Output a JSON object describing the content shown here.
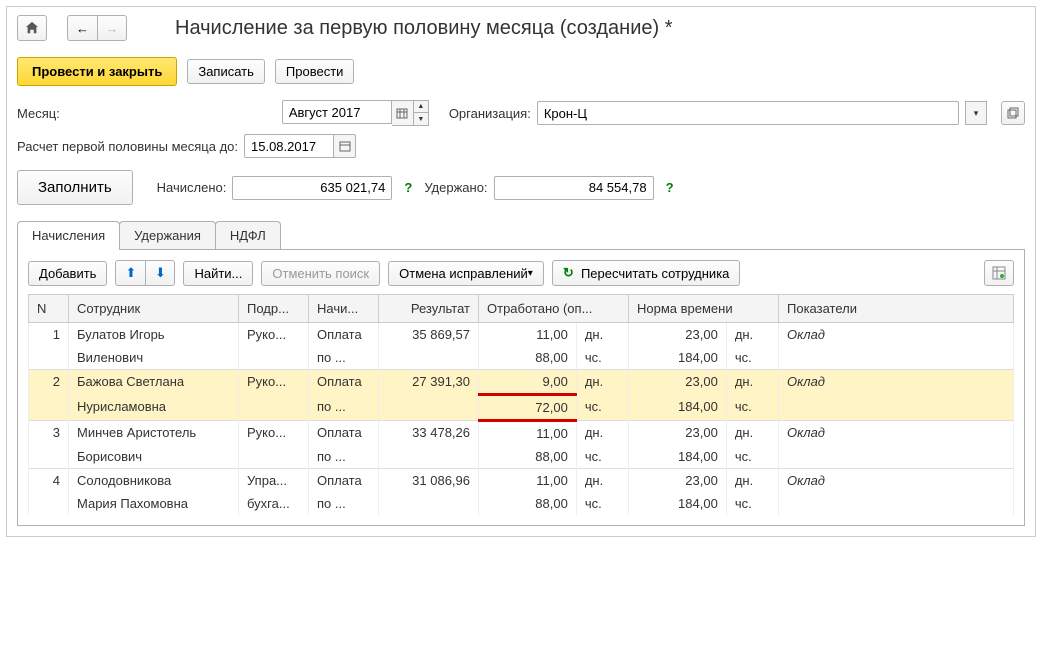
{
  "title": "Начисление за первую половину месяца (создание) *",
  "toolbar": {
    "submit_close": "Провести и закрыть",
    "save": "Записать",
    "submit": "Провести"
  },
  "fields": {
    "month_label": "Месяц:",
    "month_value": "Август 2017",
    "org_label": "Организация:",
    "org_value": "Крон-Ц",
    "calc_date_label": "Расчет первой половины месяца до:",
    "calc_date_value": "15.08.2017",
    "fill_btn": "Заполнить",
    "accrued_label": "Начислено:",
    "accrued_value": "635 021,74",
    "withheld_label": "Удержано:",
    "withheld_value": "84 554,78"
  },
  "tabs": {
    "t1": "Начисления",
    "t2": "Удержания",
    "t3": "НДФЛ"
  },
  "gridtoolbar": {
    "add": "Добавить",
    "find": "Найти...",
    "cancel_search": "Отменить поиск",
    "cancel_corrections": "Отмена исправлений",
    "recalc": "Пересчитать сотрудника"
  },
  "cols": {
    "n": "N",
    "emp": "Сотрудник",
    "dept": "Подр...",
    "accr": "Начи...",
    "result": "Результат",
    "worked": "Отработано (оп...",
    "norm": "Норма времени",
    "indic": "Показатели"
  },
  "units": {
    "days": "дн.",
    "hours": "чс."
  },
  "rows": [
    {
      "n": "1",
      "emp1": "Булатов Игорь",
      "emp2": "Виленович",
      "dept": "Руко...",
      "accr1": "Оплата",
      "accr2": "по ...",
      "result": "35 869,57",
      "wd": "11,00",
      "wh": "88,00",
      "nd": "23,00",
      "nh": "184,00",
      "ind": "Оклад",
      "hl": false
    },
    {
      "n": "2",
      "emp1": "Бажова Светлана",
      "emp2": "Нурисламовна",
      "dept": "Руко...",
      "accr1": "Оплата",
      "accr2": "по ...",
      "result": "27 391,30",
      "wd": "9,00",
      "wh": "72,00",
      "nd": "23,00",
      "nh": "184,00",
      "ind": "Оклад",
      "hl": true
    },
    {
      "n": "3",
      "emp1": "Минчев Аристотель",
      "emp2": "Борисович",
      "dept": "Руко...",
      "accr1": "Оплата",
      "accr2": "по ...",
      "result": "33 478,26",
      "wd": "11,00",
      "wh": "88,00",
      "nd": "23,00",
      "nh": "184,00",
      "ind": "Оклад",
      "hl": false
    },
    {
      "n": "4",
      "emp1": "Солодовникова",
      "emp2": "Мария Пахомовна",
      "dept": "Упра...",
      "dept2": "бухга...",
      "accr1": "Оплата",
      "accr2": "по ...",
      "result": "31 086,96",
      "wd": "11,00",
      "wh": "88,00",
      "nd": "23,00",
      "nh": "184,00",
      "ind": "Оклад",
      "hl": false
    }
  ]
}
